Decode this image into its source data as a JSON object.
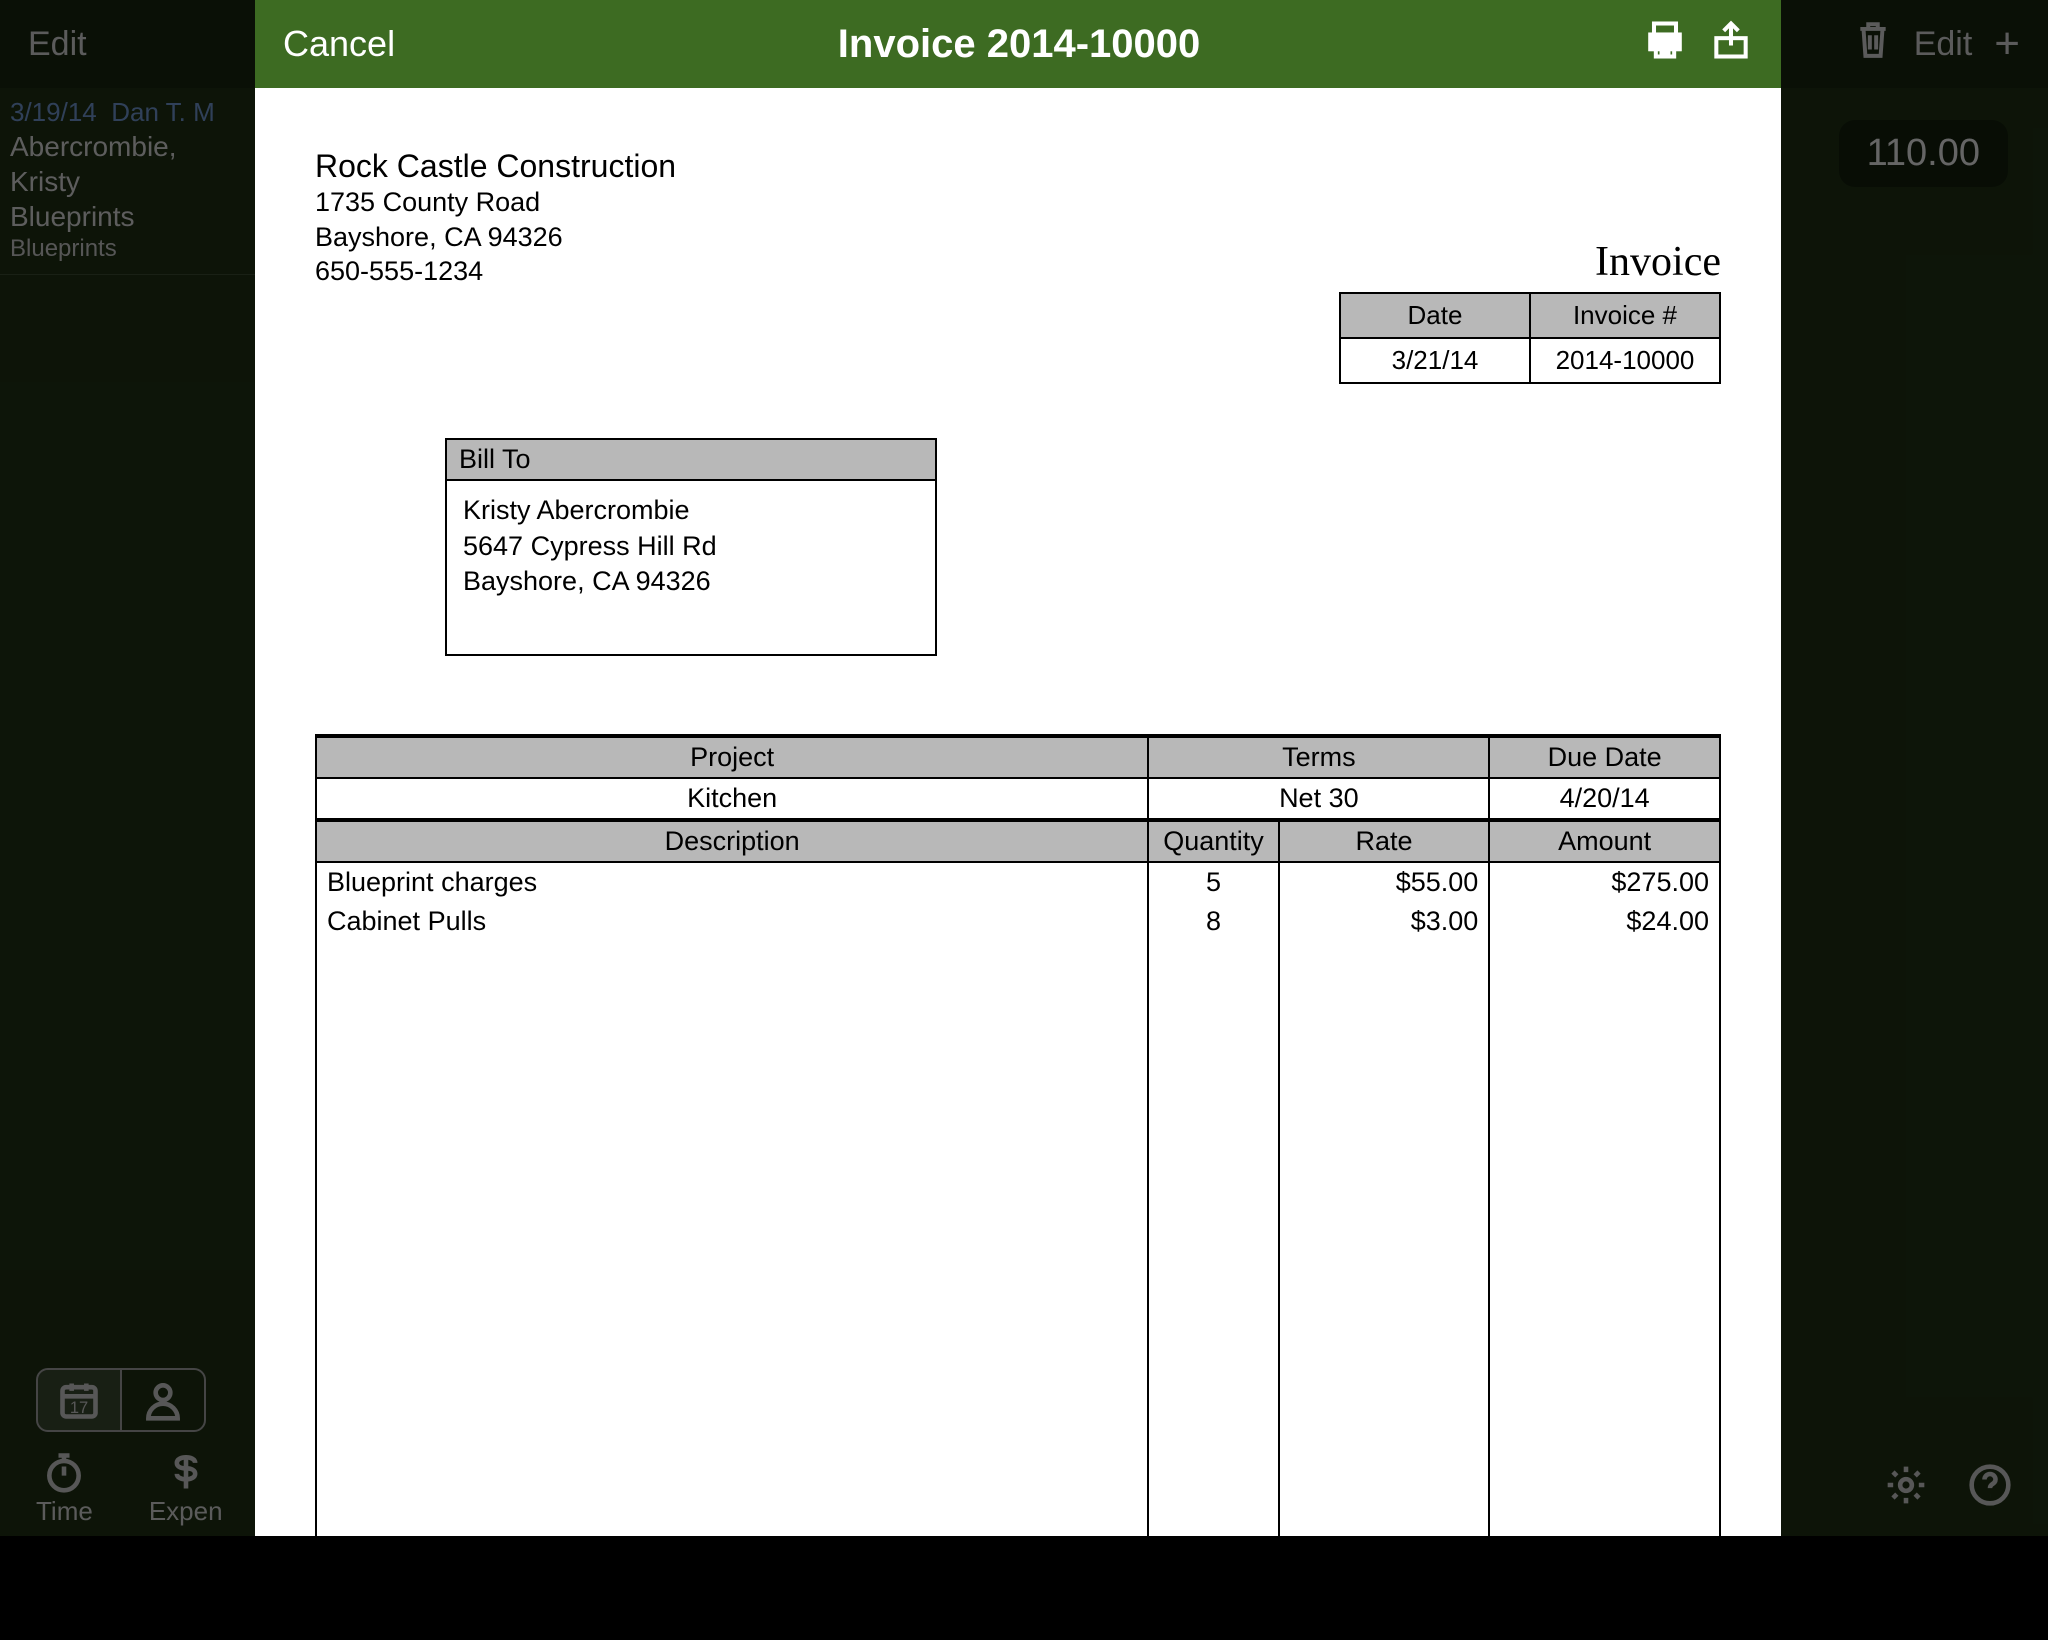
{
  "background": {
    "edit_left": "Edit",
    "edit_right": "Edit",
    "list": {
      "date": "3/19/14",
      "user": "Dan T. M",
      "customer": "Abercrombie, Kristy",
      "title": "Blueprints",
      "subtitle": "Blueprints"
    },
    "amount": "110.00",
    "tabs": {
      "time": "Time",
      "expen": "Expen"
    }
  },
  "header": {
    "cancel": "Cancel",
    "title": "Invoice 2014-10000"
  },
  "company": {
    "name": "Rock Castle Construction",
    "addr1": "1735 County Road",
    "addr2": "Bayshore, CA 94326",
    "phone": "650-555-1234"
  },
  "invoice": {
    "label": "Invoice",
    "date_h": "Date",
    "num_h": "Invoice #",
    "date": "3/21/14",
    "num": "2014-10000"
  },
  "billto": {
    "header": "Bill To",
    "l1": "Kristy Abercrombie",
    "l2": "5647 Cypress Hill Rd",
    "l3": "Bayshore, CA 94326"
  },
  "cols": {
    "project": "Project",
    "terms": "Terms",
    "due": "Due Date",
    "desc": "Description",
    "qty": "Quantity",
    "rate": "Rate",
    "amount": "Amount"
  },
  "summary": {
    "project": "Kitchen",
    "terms": "Net 30",
    "due": "4/20/14"
  },
  "lines": [
    {
      "desc": "Blueprint charges",
      "qty": "5",
      "rate": "$55.00",
      "amount": "$275.00"
    },
    {
      "desc": "Cabinet Pulls",
      "qty": "8",
      "rate": "$3.00",
      "amount": "$24.00"
    }
  ]
}
